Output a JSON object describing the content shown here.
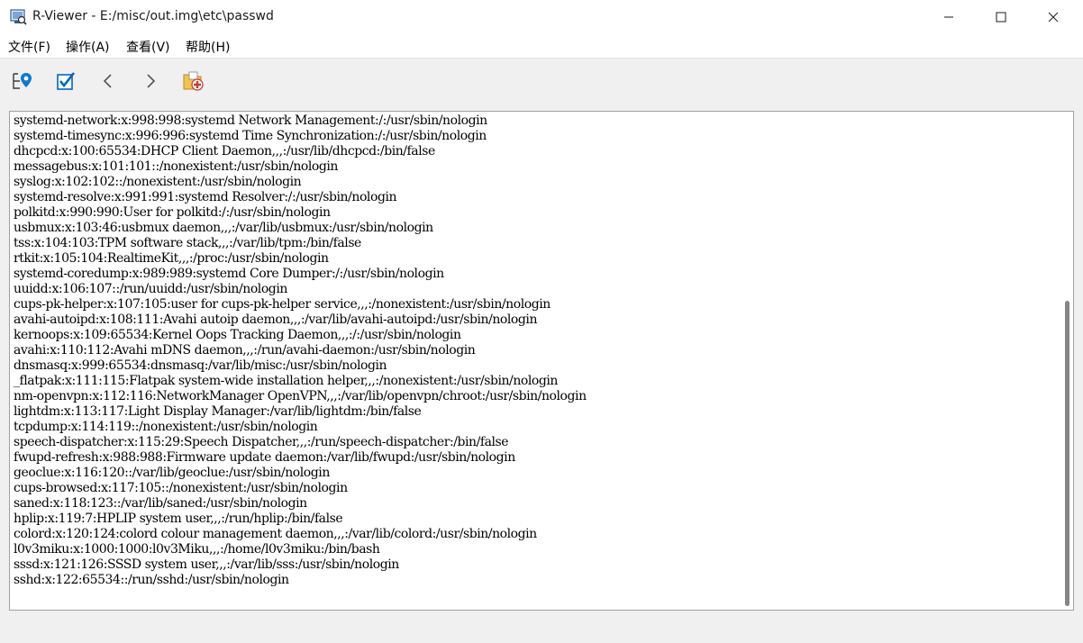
{
  "window": {
    "title": "R-Viewer - E:/misc/out.img\\etc\\passwd"
  },
  "menu": [
    {
      "label": "文件(F)"
    },
    {
      "label": "操作(A)"
    },
    {
      "label": "查看(V)"
    },
    {
      "label": "帮助(H)"
    }
  ],
  "toolbar": {
    "icons": [
      "locate-tree-icon",
      "check-icon",
      "back-icon",
      "forward-icon",
      "recover-files-icon"
    ]
  },
  "file": {
    "lines": [
      "systemd-network:x:998:998:systemd Network Management:/:/usr/sbin/nologin",
      "systemd-timesync:x:996:996:systemd Time Synchronization:/:/usr/sbin/nologin",
      "dhcpcd:x:100:65534:DHCP Client Daemon,,,:/usr/lib/dhcpcd:/bin/false",
      "messagebus:x:101:101::/nonexistent:/usr/sbin/nologin",
      "syslog:x:102:102::/nonexistent:/usr/sbin/nologin",
      "systemd-resolve:x:991:991:systemd Resolver:/:/usr/sbin/nologin",
      "polkitd:x:990:990:User for polkitd:/:/usr/sbin/nologin",
      "usbmux:x:103:46:usbmux daemon,,,:/var/lib/usbmux:/usr/sbin/nologin",
      "tss:x:104:103:TPM software stack,,,:/var/lib/tpm:/bin/false",
      "rtkit:x:105:104:RealtimeKit,,,:/proc:/usr/sbin/nologin",
      "systemd-coredump:x:989:989:systemd Core Dumper:/:/usr/sbin/nologin",
      "uuidd:x:106:107::/run/uuidd:/usr/sbin/nologin",
      "cups-pk-helper:x:107:105:user for cups-pk-helper service,,,:/nonexistent:/usr/sbin/nologin",
      "avahi-autoipd:x:108:111:Avahi autoip daemon,,,:/var/lib/avahi-autoipd:/usr/sbin/nologin",
      "kernoops:x:109:65534:Kernel Oops Tracking Daemon,,,:/:/usr/sbin/nologin",
      "avahi:x:110:112:Avahi mDNS daemon,,,:/run/avahi-daemon:/usr/sbin/nologin",
      "dnsmasq:x:999:65534:dnsmasq:/var/lib/misc:/usr/sbin/nologin",
      "_flatpak:x:111:115:Flatpak system-wide installation helper,,,:/nonexistent:/usr/sbin/nologin",
      "nm-openvpn:x:112:116:NetworkManager OpenVPN,,,:/var/lib/openvpn/chroot:/usr/sbin/nologin",
      "lightdm:x:113:117:Light Display Manager:/var/lib/lightdm:/bin/false",
      "tcpdump:x:114:119::/nonexistent:/usr/sbin/nologin",
      "speech-dispatcher:x:115:29:Speech Dispatcher,,,:/run/speech-dispatcher:/bin/false",
      "fwupd-refresh:x:988:988:Firmware update daemon:/var/lib/fwupd:/usr/sbin/nologin",
      "geoclue:x:116:120::/var/lib/geoclue:/usr/sbin/nologin",
      "cups-browsed:x:117:105::/nonexistent:/usr/sbin/nologin",
      "saned:x:118:123::/var/lib/saned:/usr/sbin/nologin",
      "hplip:x:119:7:HPLIP system user,,,:/run/hplip:/bin/false",
      "colord:x:120:124:colord colour management daemon,,,:/var/lib/colord:/usr/sbin/nologin",
      "l0v3miku:x:1000:1000:l0v3Miku,,,:/home/l0v3miku:/bin/bash",
      "sssd:x:121:126:SSSD system user,,,:/var/lib/sss:/usr/sbin/nologin",
      "sshd:x:122:65534::/run/sshd:/usr/sbin/nologin"
    ]
  },
  "scrollbar": {
    "position_fraction": 0.38,
    "visible_fraction": 0.62
  },
  "colors": {
    "accent": "#0078d4",
    "check": "#0067c0"
  }
}
